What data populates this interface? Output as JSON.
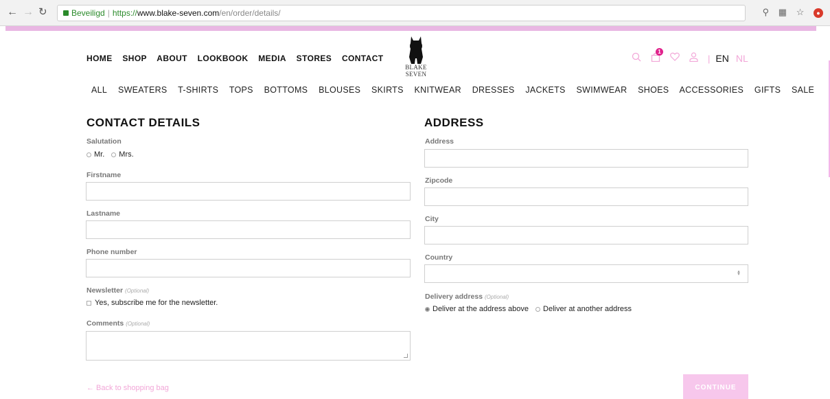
{
  "browser": {
    "secure_label": "Beveiligd",
    "url_scheme": "https://",
    "url_host": "www.blake-seven.com",
    "url_path": "/en/order/details/"
  },
  "header": {
    "nav": [
      "HOME",
      "SHOP",
      "ABOUT",
      "LOOKBOOK",
      "MEDIA",
      "STORES",
      "CONTACT"
    ],
    "logo_line1": "BLAKE",
    "logo_line2": "SEVEN",
    "cart_count": "1",
    "lang_en": "EN",
    "lang_nl": "NL",
    "lang_sep": "|"
  },
  "categories": [
    "ALL",
    "SWEATERS",
    "T-SHIRTS",
    "TOPS",
    "BOTTOMS",
    "BLOUSES",
    "SKIRTS",
    "KNITWEAR",
    "DRESSES",
    "JACKETS",
    "SWIMWEAR",
    "SHOES",
    "ACCESSORIES",
    "GIFTS",
    "SALE"
  ],
  "contact": {
    "title": "CONTACT DETAILS",
    "salutation_label": "Salutation",
    "salutation_options": [
      "Mr.",
      "Mrs."
    ],
    "firstname_label": "Firstname",
    "lastname_label": "Lastname",
    "phone_label": "Phone number",
    "newsletter_label": "Newsletter",
    "optional": "(Optional)",
    "newsletter_checkbox": "Yes, subscribe me for the newsletter.",
    "comments_label": "Comments"
  },
  "address": {
    "title": "ADDRESS",
    "address_label": "Address",
    "zipcode_label": "Zipcode",
    "city_label": "City",
    "country_label": "Country",
    "delivery_label": "Delivery address",
    "optional": "(Optional)",
    "delivery_options": [
      "Deliver at the address above",
      "Deliver at another address"
    ]
  },
  "footer": {
    "back_link": "← Back to shopping bag",
    "continue_label": "CONTINUE"
  },
  "colors": {
    "accent_pink": "#f2a7d8",
    "badge_magenta": "#e0228c",
    "button_pink": "#f7c7ec"
  }
}
